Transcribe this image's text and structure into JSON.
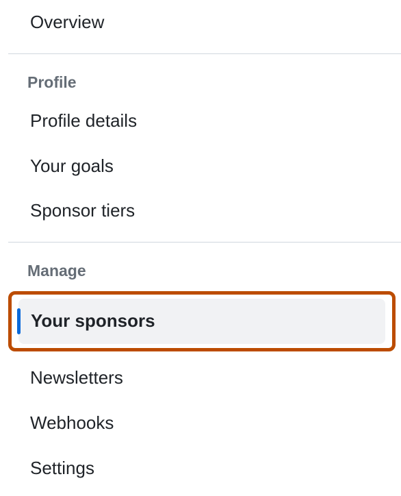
{
  "overview": {
    "label": "Overview"
  },
  "sections": {
    "profile": {
      "header": "Profile",
      "items": [
        {
          "label": "Profile details"
        },
        {
          "label": "Your goals"
        },
        {
          "label": "Sponsor tiers"
        }
      ]
    },
    "manage": {
      "header": "Manage",
      "items": [
        {
          "label": "Your sponsors"
        },
        {
          "label": "Newsletters"
        },
        {
          "label": "Webhooks"
        },
        {
          "label": "Settings"
        }
      ]
    }
  }
}
